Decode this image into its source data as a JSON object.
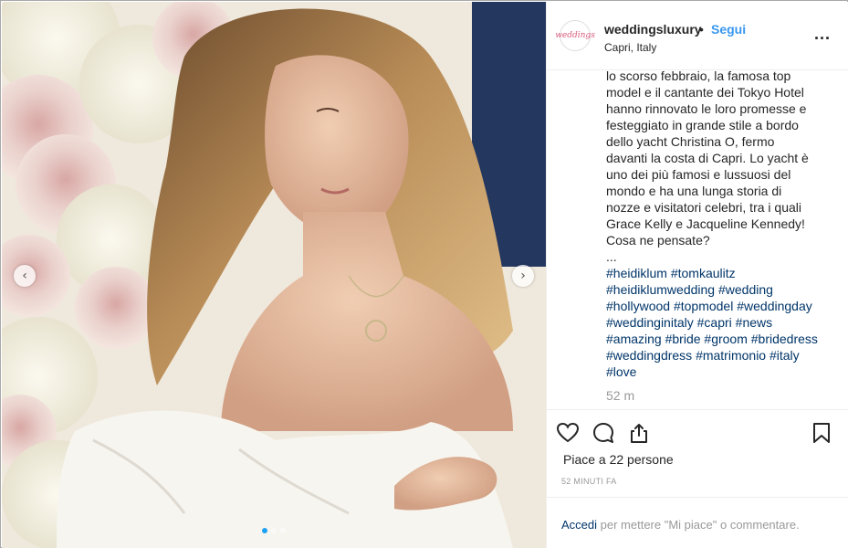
{
  "post": {
    "username": "weddingsluxury",
    "separator": "•",
    "follow_label": "Segui",
    "location": "Capri, Italy",
    "more_label": "...",
    "avatar_text": "weddings"
  },
  "caption": {
    "text": "lo scorso febbraio, la famosa top model e il cantante dei Tokyo Hotel hanno rinnovato le loro promesse e festeggiato in grande stile a bordo dello yacht Christina O, fermo davanti la costa di Capri. Lo yacht è uno dei più famosi e lussuosi del mondo e ha una lunga storia di nozze e visitatori celebri, tra i quali Grace Kelly e Jacqueline Kennedy!\nCosa ne pensate?\n...",
    "hashtags": [
      "#heidiklum",
      "#tomkaulitz",
      "#heidiklumwedding",
      "#wedding",
      "#hollywood",
      "#topmodel",
      "#weddingday",
      "#weddinginitaly",
      "#capri",
      "#news",
      "#amazing",
      "#bride",
      "#groom",
      "#bridedress",
      "#weddingdress",
      "#matrimonio",
      "#italy",
      "#love"
    ],
    "time": "52 m"
  },
  "actions": {
    "like_icon": "heart-icon",
    "comment_icon": "comment-icon",
    "share_icon": "share-icon",
    "save_icon": "bookmark-icon"
  },
  "likes_text": "Piace a 22 persone",
  "posted_text": "52 MINUTI FA",
  "login": {
    "link": "Accedi",
    "rest": " per mettere \"Mi piace\" o commentare."
  },
  "carousel": {
    "prev_icon": "chevron-left-icon",
    "next_icon": "chevron-right-icon",
    "prev_glyph": "‹",
    "next_glyph": "›"
  }
}
